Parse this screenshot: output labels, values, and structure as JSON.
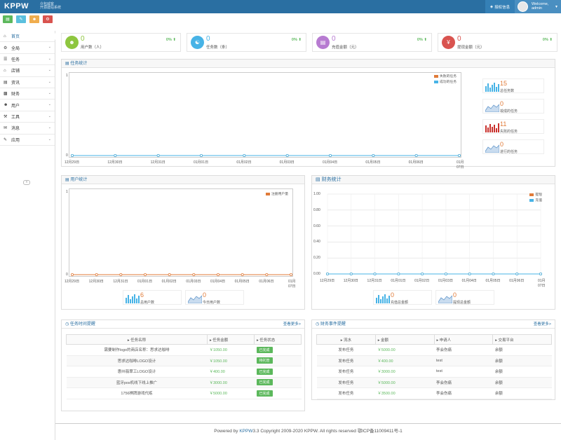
{
  "topbar": {
    "logo": "KPPW",
    "logo_sub_1": "众包威客",
    "logo_sub_2": "开源建站系统",
    "auth_label": "授权信息",
    "welcome": "Welcome,",
    "username": "admin"
  },
  "colors": {
    "brand": "#2a6fa2",
    "green": "#5cb85c",
    "orange": "#e07b39",
    "red": "#c9302c",
    "cyan": "#47b3e6"
  },
  "quick_buttons": [
    {
      "icon": "chart-icon",
      "color": "#5cb85c"
    },
    {
      "icon": "edit-icon",
      "color": "#5bc0de"
    },
    {
      "icon": "users-icon",
      "color": "#f0ad4e"
    },
    {
      "icon": "cogs-icon",
      "color": "#d9534f"
    }
  ],
  "sidebar": {
    "items": [
      {
        "label": "首页",
        "icon": "home-icon",
        "active": true
      },
      {
        "label": "全局",
        "icon": "gear-icon"
      },
      {
        "label": "任务",
        "icon": "list-icon"
      },
      {
        "label": "店铺",
        "icon": "shop-icon"
      },
      {
        "label": "资讯",
        "icon": "file-icon"
      },
      {
        "label": "财务",
        "icon": "bar-chart-icon"
      },
      {
        "label": "用户",
        "icon": "user-icon"
      },
      {
        "label": "工具",
        "icon": "tool-icon"
      },
      {
        "label": "消息",
        "icon": "message-icon"
      },
      {
        "label": "应用",
        "icon": "app-icon"
      }
    ]
  },
  "stats": [
    {
      "value": "0",
      "label": "用户数（人）",
      "pct": "0%",
      "color": "#8ec63f",
      "icon": "users-icon"
    },
    {
      "value": "0",
      "label": "任务数（条）",
      "pct": "0%",
      "color": "#47b3e6",
      "icon": "tasks-icon"
    },
    {
      "value": "0",
      "label": "充值金额（元）",
      "pct": "0%",
      "color": "#b77bd1",
      "icon": "card-icon"
    },
    {
      "value": "0",
      "label": "提现金额（元）",
      "pct": "0%",
      "color": "#d9534f",
      "icon": "yen-icon"
    }
  ],
  "task_chart": {
    "title": "任务统计",
    "legend": [
      "失败的任务",
      "成功的任务"
    ],
    "mini": [
      {
        "value": "15",
        "label": "总任务数",
        "type": "bar",
        "color": "#47b3e6"
      },
      {
        "value": "0",
        "label": "竣成的任务",
        "type": "area",
        "color": "#6699cc"
      },
      {
        "value": "11",
        "label": "失败的任务",
        "type": "bar",
        "color": "#c9302c"
      },
      {
        "value": "0",
        "label": "进行的任务",
        "type": "area",
        "color": "#6699cc"
      }
    ]
  },
  "user_chart": {
    "title": "用户统计",
    "legend": [
      "注册用户量"
    ],
    "mini": [
      {
        "value": "6",
        "label": "总用户数"
      },
      {
        "value": "0",
        "label": "今日用户数"
      }
    ]
  },
  "finance_chart": {
    "title": "财务统计",
    "legend": [
      "提现",
      "充值"
    ],
    "mini": [
      {
        "value": "0",
        "label": "充值总金额"
      },
      {
        "value": "0",
        "label": "提现总金额"
      }
    ]
  },
  "chart_data": [
    {
      "type": "line",
      "title": "任务统计",
      "x": [
        "12月29日",
        "12月30日",
        "12月31日",
        "01月01日",
        "01月02日",
        "01月03日",
        "01月04日",
        "01月05日",
        "01月06日",
        "01月07日"
      ],
      "series": [
        {
          "name": "失败的任务",
          "values": [
            0,
            0,
            0,
            0,
            0,
            0,
            0,
            0,
            0,
            0
          ],
          "color": "#e07b39"
        },
        {
          "name": "成功的任务",
          "values": [
            0,
            0,
            0,
            0,
            0,
            0,
            0,
            0,
            0,
            0
          ],
          "color": "#47b3e6"
        }
      ],
      "ylim": [
        0,
        1
      ],
      "yticks": [
        "0",
        "1"
      ],
      "legend_position": "top-right",
      "grid": false
    },
    {
      "type": "line",
      "title": "用户统计",
      "x": [
        "12月29日",
        "12月30日",
        "12月31日",
        "01月01日",
        "01月02日",
        "01月03日",
        "01月04日",
        "01月05日",
        "01月06日",
        "01月07日"
      ],
      "series": [
        {
          "name": "注册用户量",
          "values": [
            0,
            0,
            0,
            0,
            0,
            0,
            0,
            0,
            0,
            0
          ],
          "color": "#e07b39"
        }
      ],
      "ylim": [
        0,
        1
      ],
      "yticks": [
        "0",
        "1"
      ],
      "legend_position": "top-right",
      "grid": false
    },
    {
      "type": "line",
      "title": "财务统计",
      "x": [
        "12月29日",
        "12月30日",
        "12月31日",
        "01月01日",
        "01月02日",
        "01月03日",
        "01月04日",
        "01月05日",
        "01月06日",
        "01月07日"
      ],
      "series": [
        {
          "name": "提现",
          "values": [
            0,
            0,
            0,
            0,
            0,
            0,
            0,
            0,
            0,
            0
          ],
          "color": "#e07b39"
        },
        {
          "name": "充值",
          "values": [
            0,
            0,
            0,
            0,
            0,
            0,
            0,
            0,
            0,
            0
          ],
          "color": "#47b3e6"
        }
      ],
      "ylim": [
        0,
        1
      ],
      "yticks": [
        "0.00",
        "0.20",
        "0.40",
        "0.60",
        "0.80",
        "1.00"
      ],
      "legend_position": "top-right",
      "grid": true
    }
  ],
  "task_reminder": {
    "title": "任务时间提醒",
    "more": "查看更多>",
    "headers": [
      "任务名称",
      "任务金额",
      "任务状态"
    ],
    "rows": [
      [
        "需要制作logo的商店名称：思求达咖啡",
        "￥1050.00",
        "已完成"
      ],
      [
        "思求达咖啡LOGO设计",
        "￥1050.00",
        "待托管"
      ],
      [
        "惠州翡翠工LOGO设计",
        "￥400.00",
        "已完成"
      ],
      [
        "蓝牙pos机线下线上推广",
        "￥3000.00",
        "已完成"
      ],
      [
        "1756棋牌游戏代练",
        "￥5000.00",
        "已完成"
      ]
    ]
  },
  "finance_reminder": {
    "title": "财务事件提醒",
    "more": "查看更多>",
    "headers": [
      "流水",
      "金额",
      "申请人",
      "交易平台"
    ],
    "rows": [
      [
        "发布任务",
        "￥5000.00",
        "李会伤痛",
        "余额"
      ],
      [
        "发布任务",
        "￥400.00",
        "test",
        "余额"
      ],
      [
        "发布任务",
        "￥3000.00",
        "test",
        "余额"
      ],
      [
        "发布任务",
        "￥5000.00",
        "李会伤痛",
        "余额"
      ],
      [
        "发布任务",
        "￥3500.00",
        "李会伤痛",
        "余额"
      ]
    ]
  },
  "footer": {
    "prefix": "Powered by ",
    "brand": "KPPW",
    "suffix": "3.3 Copyright 2009-2020 KPPW. All rights reserved 鄂ICP备11009411号-1"
  }
}
